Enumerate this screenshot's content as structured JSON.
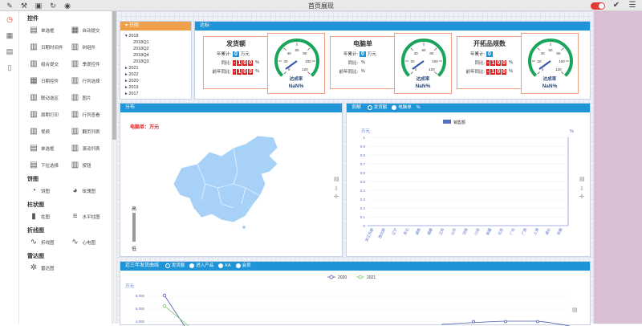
{
  "topbar": {
    "title": "首页展现",
    "tools": [
      "tool-icon",
      "build-icon",
      "save-icon",
      "refresh-icon",
      "eye-icon"
    ]
  },
  "panel": {
    "sections": [
      {
        "title": "控件",
        "items": [
          {
            "label": "单选框",
            "icon": "▤"
          },
          {
            "label": "自动提交",
            "icon": "▦"
          },
          {
            "label": "日期时间件",
            "icon": "▥"
          },
          {
            "label": "树组件",
            "icon": "▥"
          },
          {
            "label": "组合提交",
            "icon": "▥"
          },
          {
            "label": "季度控件",
            "icon": "▥"
          },
          {
            "label": "日期控件",
            "icon": "▦"
          },
          {
            "label": "行列选择",
            "icon": "▥"
          },
          {
            "label": "联动选区",
            "icon": "▥"
          },
          {
            "label": "图片",
            "icon": "▥"
          },
          {
            "label": "周期打印",
            "icon": "▥"
          },
          {
            "label": "行列查看",
            "icon": "▥"
          },
          {
            "label": "视频",
            "icon": "▥"
          },
          {
            "label": "翻页列表",
            "icon": "▥"
          },
          {
            "label": "单选框",
            "icon": "▤"
          },
          {
            "label": "滚动列表",
            "icon": "▥"
          },
          {
            "label": "下拉选择",
            "icon": "▤"
          },
          {
            "label": "按钮",
            "icon": "▥"
          }
        ]
      },
      {
        "title": "饼图",
        "items": [
          {
            "label": "饼图",
            "icon": "◔"
          },
          {
            "label": "玫瑰图",
            "icon": "◕"
          }
        ]
      },
      {
        "title": "柱状图",
        "items": [
          {
            "label": "柱图",
            "icon": "▮"
          },
          {
            "label": "水平柱图",
            "icon": "≡"
          }
        ]
      },
      {
        "title": "折线图",
        "items": [
          {
            "label": "折线图",
            "icon": "∿"
          },
          {
            "label": "心电图",
            "icon": "∿"
          }
        ]
      },
      {
        "title": "雷达图",
        "items": [
          {
            "label": "雷达图",
            "icon": "✲"
          }
        ]
      }
    ]
  },
  "date_card": {
    "header": "日期",
    "tree": [
      {
        "label": "2018",
        "expanded": true,
        "children": [
          "2018Q1",
          "2018Q2",
          "2018Q4",
          "2018Q3"
        ]
      },
      {
        "label": "2021"
      },
      {
        "label": "2022"
      },
      {
        "label": "2020"
      },
      {
        "label": "2019"
      },
      {
        "label": "2017"
      }
    ]
  },
  "kpi_card": {
    "header": "达标",
    "items": [
      {
        "title": "发货额",
        "ytd_label": "年累计:",
        "ytd": "0",
        "unit": "万元",
        "yoy_label": "同比:",
        "yoy": "-100",
        "yoy_unit": "%",
        "prev_label": "前年同比:",
        "prev": "-100",
        "prev_unit": "%",
        "gauge_title": "达成率",
        "gauge_value": "NaN%"
      },
      {
        "title": "电脑单",
        "ytd_label": "年累计:",
        "ytd": "0",
        "unit": "万元",
        "yoy_label": "同比:",
        "yoy": "",
        "yoy_unit": "%",
        "prev_label": "前年同比:",
        "prev": "",
        "prev_unit": "%",
        "gauge_title": "达成率",
        "gauge_value": "NaN%"
      },
      {
        "title": "开拓品规数",
        "ytd_label": "年累计:",
        "ytd": "0",
        "unit": "",
        "yoy_label": "同比:",
        "yoy": "-100",
        "yoy_unit": "%",
        "prev_label": "前年同比:",
        "prev": "-100",
        "prev_unit": "%",
        "gauge_title": "达成率",
        "gauge_value": "NaN%"
      }
    ],
    "gauge_ticks": [
      "0",
      "20",
      "40",
      "60",
      "80",
      "100",
      "120"
    ]
  },
  "map_card": {
    "header": "分布",
    "subtitle": "电脑单：万元",
    "legend_high": "高",
    "legend_low": "低"
  },
  "bar_card": {
    "header": "贡献",
    "tabs": [
      {
        "label": "发货额",
        "active": true
      },
      {
        "label": "电脑单",
        "active": false
      }
    ],
    "tab_extra": "%",
    "legend": "销售额",
    "y_unit_left": "万元",
    "y_unit_right": "%",
    "chart_data": {
      "type": "bar",
      "categories": [
        "浙江东部",
        "西北部",
        "辽宁",
        "苏北",
        "湖南",
        "福建",
        "江苏",
        "山东",
        "河南",
        "川渝",
        "新疆",
        "北京",
        "广东",
        "广西",
        "上海",
        "湖北",
        "安徽"
      ],
      "values": [
        0,
        0,
        0,
        0,
        0,
        0,
        0,
        0,
        0,
        0,
        0,
        0,
        0,
        0,
        0,
        0,
        0
      ],
      "ylim": [
        0,
        1
      ],
      "yticks": [
        "0",
        "0.1",
        "0.2",
        "0.3",
        "0.4",
        "0.5",
        "0.6",
        "0.7",
        "0.8",
        "0.9",
        "1"
      ]
    }
  },
  "line_card": {
    "header": "近三年发货曲线",
    "tabs": [
      {
        "label": "发货额",
        "active": true
      },
      {
        "label": "进入产品",
        "active": false
      },
      {
        "label": "KA",
        "active": false
      },
      {
        "label": "会员",
        "active": false
      }
    ],
    "y_unit": "万元",
    "chart_data": {
      "type": "line",
      "series": [
        {
          "name": "2020",
          "color": "#4a5ab0"
        },
        {
          "name": "2021",
          "color": "#7cc26b"
        }
      ],
      "yticks": [
        "8,000",
        "6,000",
        "4,000"
      ]
    }
  }
}
